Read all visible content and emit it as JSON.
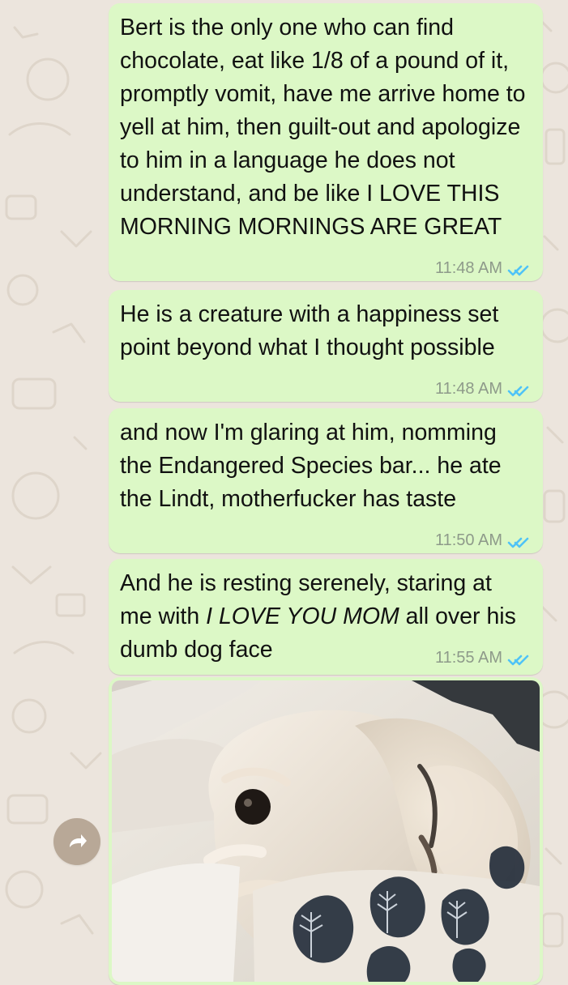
{
  "chat": {
    "messages": [
      {
        "text": "Bert is the only one who can find chocolate, eat like 1/8 of a pound of it, promptly vomit, have me arrive home to yell at him, then guilt-out and apologize to him in a language he does not understand, and be like I LOVE THIS MORNING MORNINGS ARE GREAT",
        "time": "11:48 AM",
        "status_icon": "double-check-icon"
      },
      {
        "text": "He is a creature with a happiness set point beyond what I thought possible",
        "time": "11:48 AM",
        "status_icon": "double-check-icon"
      },
      {
        "text": "and now I'm glaring at him, nomming the Endangered Species bar... he ate the Lindt, motherfucker has taste",
        "time": "11:50 AM",
        "status_icon": "double-check-icon"
      },
      {
        "text_before": "And he is resting serenely, staring at me with ",
        "text_italic": "I LOVE YOU MOM",
        "text_after": " all over his dumb dog face",
        "time": "11:55 AM",
        "status_icon": "double-check-icon"
      }
    ],
    "photo_message": {
      "alt": "",
      "icon": "image-message"
    },
    "forward_button": {
      "icon": "forward-icon"
    }
  },
  "colors": {
    "background": "#ece5dd",
    "outgoing_bubble": "#dcf8c6",
    "timestamp": "#8e9a8a",
    "read_ticks": "#4fc3f7",
    "forward_button": "#b8a897"
  }
}
